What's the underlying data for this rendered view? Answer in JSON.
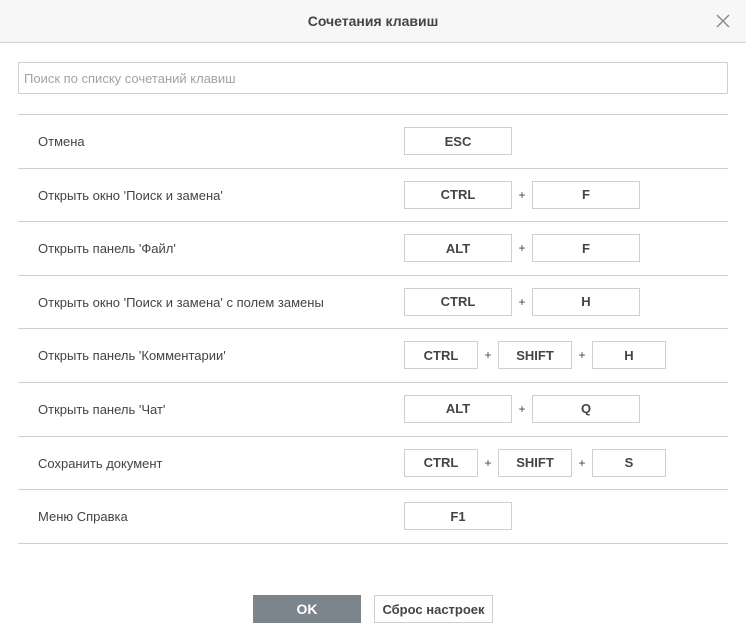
{
  "dialog": {
    "title": "Сочетания клавиш",
    "close_icon": "close-icon"
  },
  "search": {
    "placeholder": "Поиск по списку сочетаний клавиш",
    "value": ""
  },
  "shortcuts": [
    {
      "label": "Отмена",
      "keys": [
        "ESC"
      ]
    },
    {
      "label": "Открыть окно 'Поиск и замена'",
      "keys": [
        "CTRL",
        "F"
      ]
    },
    {
      "label": "Открыть панель 'Файл'",
      "keys": [
        "ALT",
        "F"
      ]
    },
    {
      "label": "Открыть окно 'Поиск и замена' с полем замены",
      "keys": [
        "CTRL",
        "H"
      ]
    },
    {
      "label": "Открыть панель 'Комментарии'",
      "keys": [
        "CTRL",
        "SHIFT",
        "H"
      ]
    },
    {
      "label": "Открыть панель 'Чат'",
      "keys": [
        "ALT",
        "Q"
      ]
    },
    {
      "label": "Сохранить документ",
      "keys": [
        "CTRL",
        "SHIFT",
        "S"
      ]
    },
    {
      "label": "Меню Справка",
      "keys": [
        "F1"
      ]
    }
  ],
  "separator": "+",
  "footer": {
    "ok_label": "OK",
    "reset_label": "Сброс настроек"
  },
  "colors": {
    "ok_button_bg": "#7d858c",
    "header_bg": "#f7f7f7",
    "border": "#cfcfcf",
    "text": "#444444"
  }
}
